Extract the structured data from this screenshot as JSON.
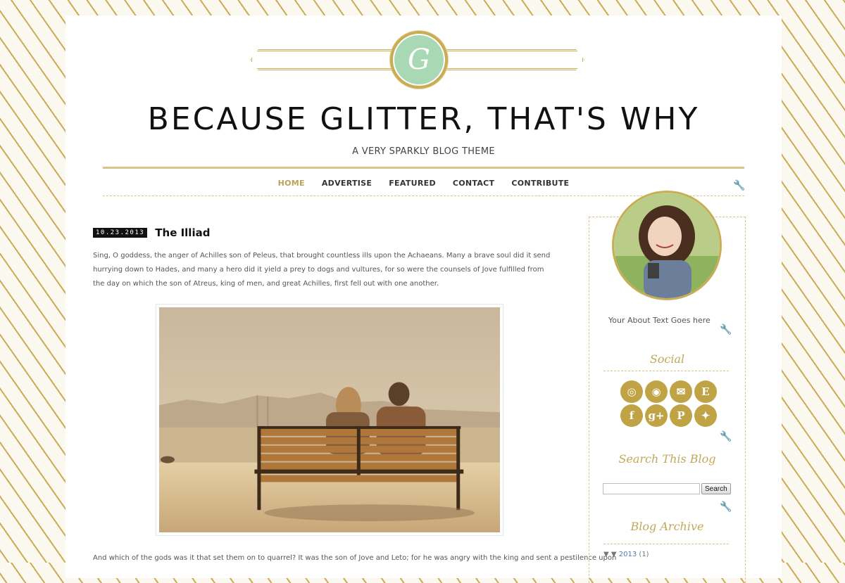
{
  "header": {
    "logo_letter": "G",
    "title": "BECAUSE GLITTER, THAT'S WHY",
    "tagline": "A VERY SPARKLY BLOG THEME"
  },
  "nav": {
    "items": [
      {
        "label": "HOME",
        "active": true
      },
      {
        "label": "ADVERTISE",
        "active": false
      },
      {
        "label": "FEATURED",
        "active": false
      },
      {
        "label": "CONTACT",
        "active": false
      },
      {
        "label": "CONTRIBUTE",
        "active": false
      }
    ]
  },
  "post": {
    "date": "10.23.2013",
    "title": "The Illiad",
    "body": "Sing, O goddess, the anger of Achilles son of Peleus, that brought countless ills upon the Achaeans. Many a brave soul did it send hurrying down to Hades, and many a hero did it yield a prey to dogs and vultures, for so were the counsels of Jove fulfilled from the day on which the son of Atreus, king of men, and great Achilles, first fell out with one another.",
    "body2": "And which of the gods was it that set them on to quarrel? It was the son of Jove and Leto; for he was angry with the king and sent a pestilence upon"
  },
  "sidebar": {
    "about_text": "Your About Text Goes here",
    "social_title": "Social",
    "social_icons": [
      "instagram-icon",
      "rss-icon",
      "email-icon",
      "etsy-icon",
      "facebook-icon",
      "google-plus-icon",
      "pinterest-icon",
      "twitter-icon"
    ],
    "social_glyphs": [
      "◎",
      "◉",
      "✉",
      "E",
      "f",
      "g+",
      "P",
      "✦"
    ],
    "search_title": "Search This Blog",
    "search_button": "Search",
    "search_value": "",
    "archive_title": "Blog Archive",
    "archive_toggle": "▼",
    "archive_year": "2013",
    "archive_count": "(1)"
  },
  "colors": {
    "gold": "#c9ac55",
    "mint": "#a9d8b5",
    "nav_active": "#b9a25a"
  }
}
